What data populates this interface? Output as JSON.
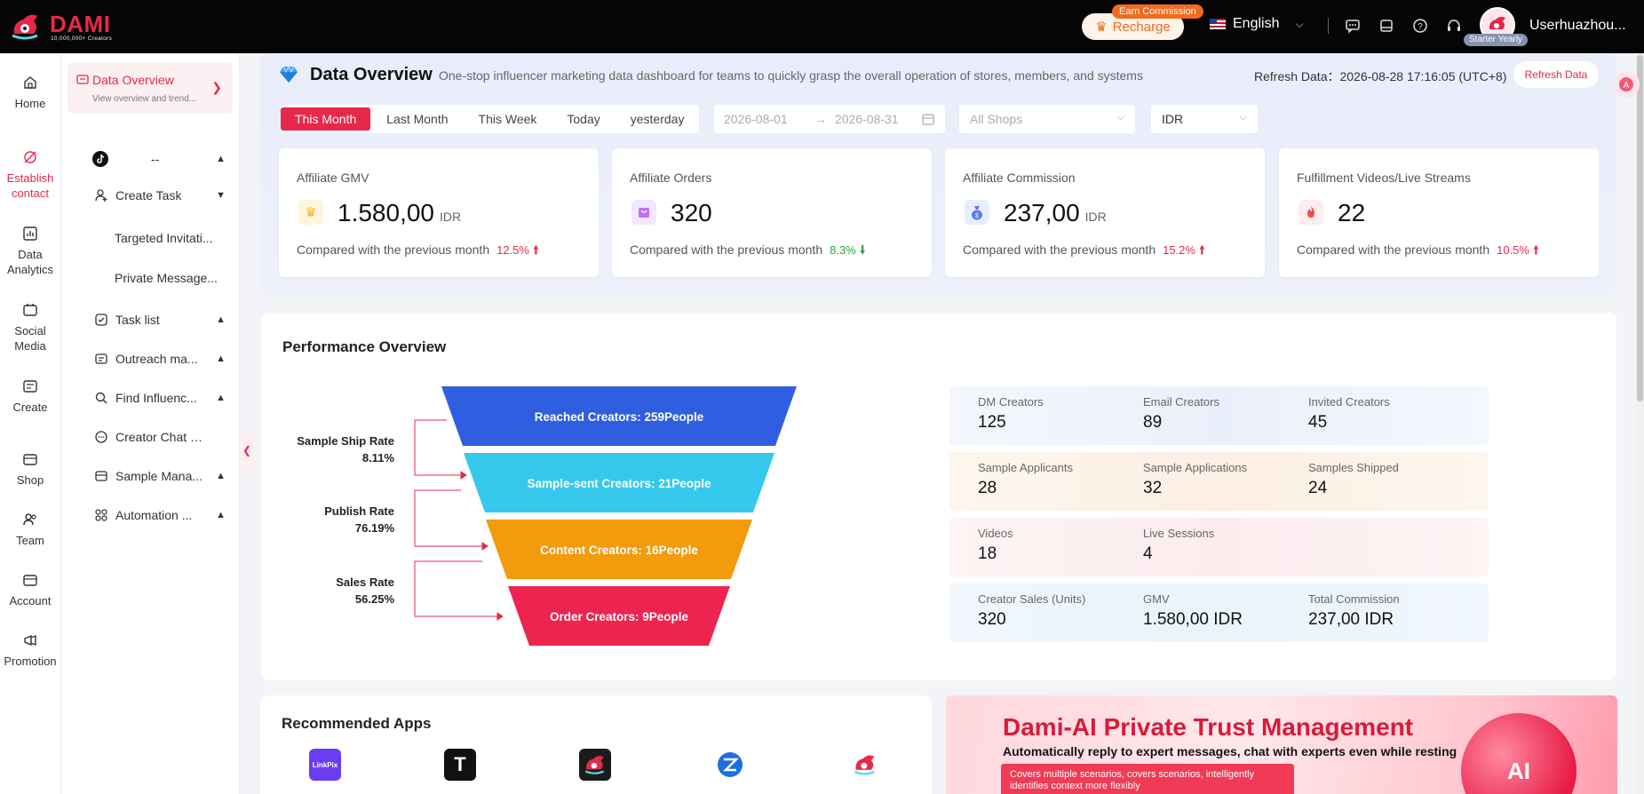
{
  "header": {
    "logo_text": "DAMI",
    "logo_tagline": "10,000,000+ Creators",
    "recharge_label": "Recharge",
    "earn_badge": "Earn Commission",
    "language": "English",
    "username": "Userhuazhou...",
    "plan_badge": "Starter Yearly",
    "icons": [
      "chat-icon",
      "layout-icon",
      "help-icon",
      "headset-icon"
    ]
  },
  "rail": {
    "items": [
      {
        "label": "Home",
        "icon": "home-icon"
      },
      {
        "label": "Establish contact",
        "icon": "link-icon",
        "active": true
      },
      {
        "label": "Data Analytics",
        "icon": "chart-icon"
      },
      {
        "label": "Social Media",
        "icon": "social-icon"
      },
      {
        "label": "Create",
        "icon": "create-icon"
      },
      {
        "label": "Shop",
        "icon": "shop-icon"
      },
      {
        "label": "Team",
        "icon": "team-icon"
      },
      {
        "label": "Account",
        "icon": "account-icon"
      },
      {
        "label": "Promotion",
        "icon": "megaphone-icon"
      }
    ]
  },
  "subnav": {
    "active": {
      "title": "Data Overview",
      "desc": "View overview and trend..."
    },
    "platform_label": "--",
    "items": [
      {
        "label": "Create Task"
      },
      {
        "label": "Targeted Invitati..."
      },
      {
        "label": "Private Message..."
      },
      {
        "label": "Task list"
      },
      {
        "label": "Outreach ma..."
      },
      {
        "label": "Find Influenc..."
      },
      {
        "label": "Creator Chat Wi..."
      },
      {
        "label": "Sample Mana..."
      },
      {
        "label": "Automation ..."
      }
    ]
  },
  "overview": {
    "title": "Data Overview",
    "description": "One-stop influencer marketing data dashboard for teams to quickly grasp the overall operation of stores, members, and systems",
    "refresh_time": "Refresh Data：2026-08-28 17:16:05 (UTC+8)",
    "refresh_button": "Refresh Data",
    "tabs": [
      "This Month",
      "Last Month",
      "This Week",
      "Today",
      "yesterday"
    ],
    "date_start": "2026-08-01",
    "date_end": "2026-08-31",
    "date_arrow": "→",
    "shops_placeholder": "All Shops",
    "currency": "IDR"
  },
  "cards": [
    {
      "title": "Affiliate GMV",
      "value": "1.580,00",
      "unit": "IDR",
      "compare": "Compared with the previous month",
      "pct": "12.5%",
      "trend": "up"
    },
    {
      "title": "Affiliate Orders",
      "value": "320",
      "unit": "",
      "compare": "Compared with the previous month",
      "pct": "8.3%",
      "trend": "down"
    },
    {
      "title": "Affiliate Commission",
      "value": "237,00",
      "unit": "IDR",
      "compare": "Compared with the previous month",
      "pct": "15.2%",
      "trend": "up"
    },
    {
      "title": "Fulfillment Videos/Live Streams",
      "value": "22",
      "unit": "",
      "compare": "Compared with the previous month",
      "pct": "10.5%",
      "trend": "up"
    }
  ],
  "performance": {
    "title": "Performance Overview",
    "funnel": [
      {
        "label": "Reached Creators: 259People",
        "color": "#2f5fe0"
      },
      {
        "label": "Sample-sent Creators: 21People",
        "color": "#35c8ec"
      },
      {
        "label": "Content Creators: 16People",
        "color": "#f29b0c"
      },
      {
        "label": "Order Creators: 9People",
        "color": "#ee2450"
      }
    ],
    "rates": [
      {
        "name": "Sample Ship Rate",
        "value": "8.11%"
      },
      {
        "name": "Publish Rate",
        "value": "76.19%"
      },
      {
        "name": "Sales Rate",
        "value": "56.25%"
      }
    ],
    "stat_rows": [
      {
        "bg": "#eef2fb",
        "stats": [
          {
            "label": "DM Creators",
            "value": "125"
          },
          {
            "label": "Email Creators",
            "value": "89"
          },
          {
            "label": "Invited Creators",
            "value": "45"
          }
        ]
      },
      {
        "bg": "#fdf3ea",
        "stats": [
          {
            "label": "Sample Applicants",
            "value": "28"
          },
          {
            "label": "Sample Applications",
            "value": "32"
          },
          {
            "label": "Samples Shipped",
            "value": "24"
          }
        ]
      },
      {
        "bg": "#fdf0f1",
        "stats": [
          {
            "label": "Videos",
            "value": "18"
          },
          {
            "label": "Live Sessions",
            "value": "4"
          }
        ]
      },
      {
        "bg": "#eef6fc",
        "stats": [
          {
            "label": "Creator Sales (Units)",
            "value": "320"
          },
          {
            "label": "GMV",
            "value": "1.580,00 IDR"
          },
          {
            "label": "Total Commission",
            "value": "237,00 IDR"
          }
        ]
      }
    ]
  },
  "apps": {
    "title": "Recommended Apps",
    "items": [
      {
        "name": "LinkPix",
        "color": "#6a3df0"
      },
      {
        "name": "T",
        "color": "#111111"
      },
      {
        "name": "dami-dark",
        "color": "#1b1b1b"
      },
      {
        "name": "z-app",
        "color": "#ffffff"
      },
      {
        "name": "dami-light",
        "color": "#ffffff"
      }
    ]
  },
  "banner": {
    "headline": "Dami-AI Private Trust Management",
    "subline": "Automatically reply to expert messages, chat with experts even while resting",
    "pill": "Covers multiple scenarios, covers scenarios, intelligently identifies context more flexibly",
    "badge": "AI"
  }
}
